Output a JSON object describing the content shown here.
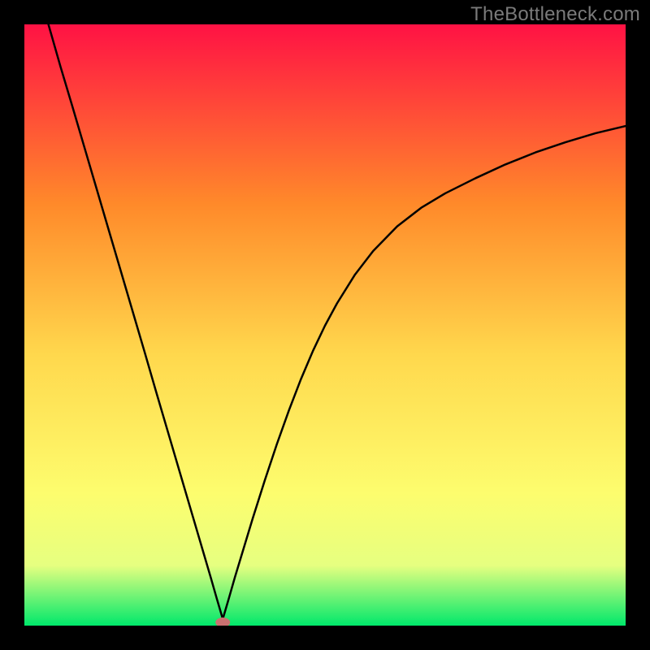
{
  "watermark": "TheBottleneck.com",
  "chart_data": {
    "type": "line",
    "title": "",
    "xlabel": "",
    "ylabel": "",
    "xlim": [
      0,
      100
    ],
    "ylim": [
      0,
      100
    ],
    "grid": false,
    "legend": false,
    "background_gradient": {
      "top": "#ff1244",
      "mid_upper": "#ff8a2a",
      "mid": "#ffd84d",
      "mid_lower": "#fdfd6e",
      "lower": "#e6ff80",
      "bottom": "#00e86b"
    },
    "marker": {
      "x": 33,
      "y": 0,
      "color": "#c97171",
      "radius_px": 7
    },
    "series": [
      {
        "name": "curve",
        "color": "#000000",
        "x": [
          4,
          6,
          8,
          10,
          12,
          14,
          16,
          18,
          20,
          22,
          24,
          26,
          28,
          30,
          31,
          32,
          33,
          34,
          35,
          36,
          38,
          40,
          42,
          44,
          46,
          48,
          50,
          52,
          55,
          58,
          62,
          66,
          70,
          75,
          80,
          85,
          90,
          95,
          100
        ],
        "y": [
          100,
          93,
          86.3,
          79.5,
          72.7,
          65.9,
          59.1,
          52.3,
          45.5,
          38.6,
          31.8,
          25.0,
          18.2,
          11.4,
          8.0,
          4.5,
          1.1,
          4.5,
          8.0,
          11.3,
          17.9,
          24.2,
          30.2,
          35.8,
          41.0,
          45.7,
          49.9,
          53.6,
          58.4,
          62.3,
          66.4,
          69.5,
          71.9,
          74.4,
          76.7,
          78.7,
          80.4,
          81.9,
          83.1
        ]
      }
    ]
  }
}
